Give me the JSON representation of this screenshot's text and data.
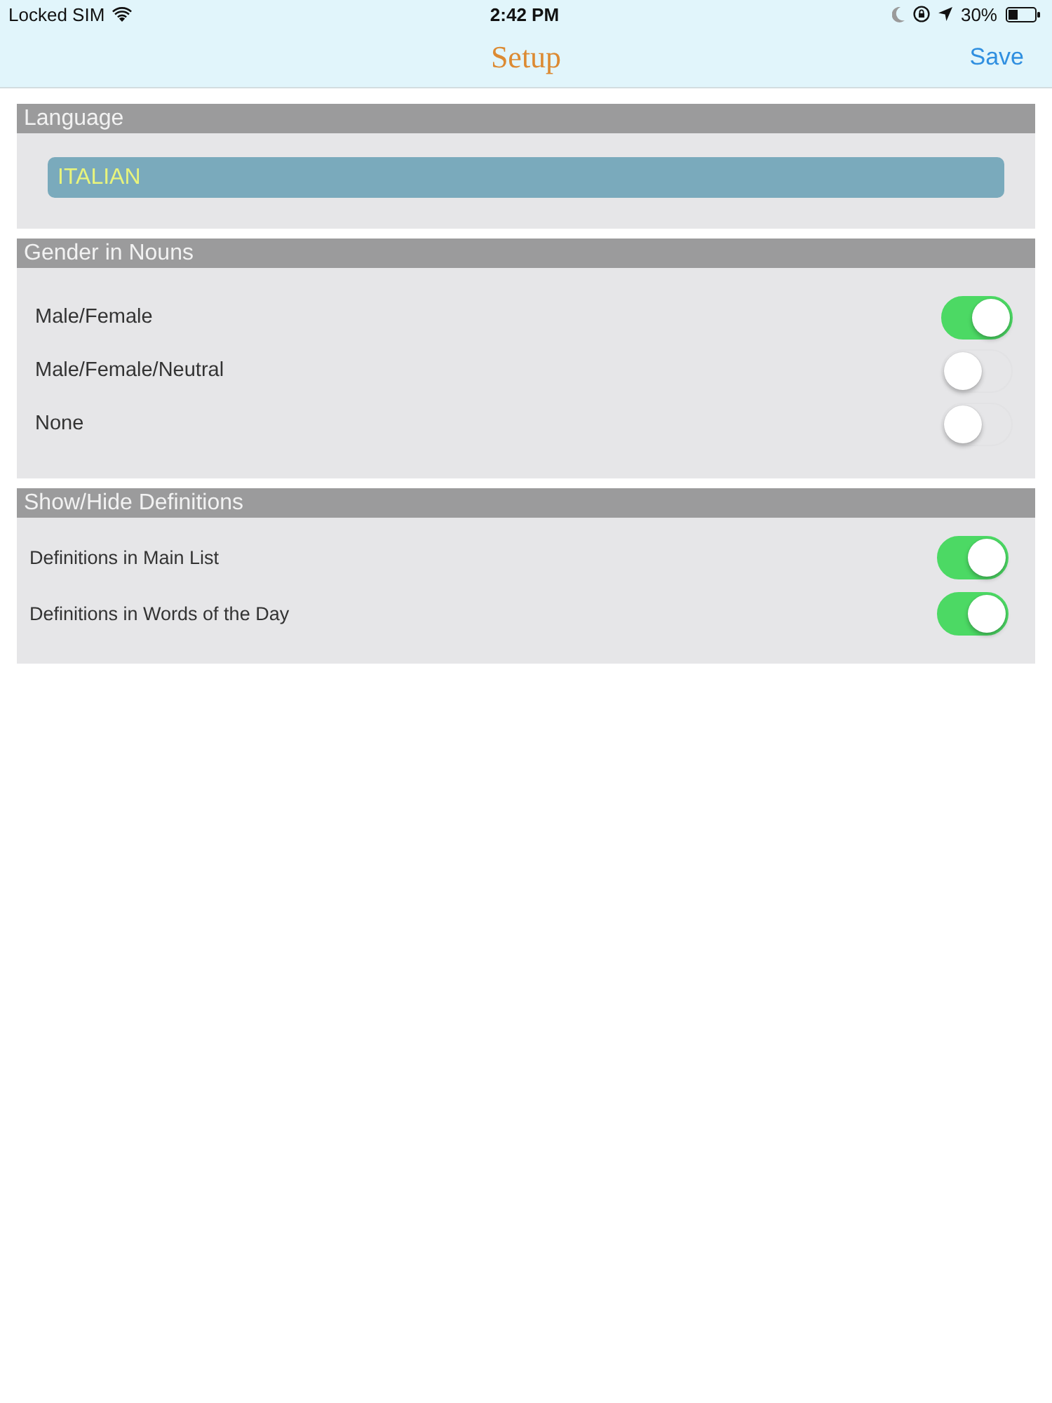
{
  "status_bar": {
    "carrier": "Locked SIM",
    "time": "2:42 PM",
    "battery": "30%"
  },
  "nav_bar": {
    "title": "Setup",
    "action": "Save"
  },
  "sections": [
    {
      "title": "Language",
      "kind": "picker",
      "value": "ITALIAN"
    },
    {
      "title": "Gender in Nouns",
      "kind": "choice",
      "rows": [
        {
          "label": "Male/Female",
          "on": true
        },
        {
          "label": "Male/Female/Neutral",
          "on": false
        },
        {
          "label": "None",
          "on": false
        }
      ]
    },
    {
      "title": "Show/Hide Definitions",
      "kind": "toggles",
      "rows": [
        {
          "label": "Definitions in Main List",
          "on": true
        },
        {
          "label": "Definitions in Words of the Day",
          "on": true
        }
      ]
    }
  ]
}
